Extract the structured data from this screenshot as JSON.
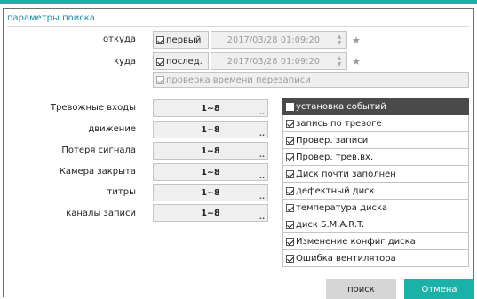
{
  "title": "параметры поиска",
  "from": {
    "label": "откуда",
    "mode_label": "первый",
    "mode_checked": true,
    "datetime": "2017/03/28  01:09:20"
  },
  "to": {
    "label": "куда",
    "mode_label": "послед.",
    "mode_checked": true,
    "datetime": "2017/03/28  01:09:20"
  },
  "verify_overwrite": {
    "label": "проверка времени перезаписи",
    "checked": true
  },
  "selectors": [
    {
      "label": "Тревожные входы",
      "value": "1~8"
    },
    {
      "label": "движение",
      "value": "1~8"
    },
    {
      "label": "Потеря сигнала",
      "value": "1~8"
    },
    {
      "label": "Камера закрыта",
      "value": "1~8"
    },
    {
      "label": "титры",
      "value": "1~8"
    },
    {
      "label": "каналы записи",
      "value": "1~8"
    }
  ],
  "events": [
    {
      "label": "установка событий",
      "checked": false
    },
    {
      "label": "запись по тревоге",
      "checked": true
    },
    {
      "label": "Провер. записи",
      "checked": true
    },
    {
      "label": "Провер. трев.вх.",
      "checked": true
    },
    {
      "label": "Диск почти заполнен",
      "checked": true
    },
    {
      "label": "дефектный диск",
      "checked": true
    },
    {
      "label": "температура диска",
      "checked": true
    },
    {
      "label": "диск S.M.A.R.T.",
      "checked": true
    },
    {
      "label": "Изменение конфиг диска",
      "checked": true
    },
    {
      "label": "Ошибка вентилятора",
      "checked": true
    }
  ],
  "buttons": {
    "search": "поиск",
    "cancel": "Отмена"
  },
  "colors": {
    "accent": "#1ab1a8",
    "title": "#1a8fa0",
    "header_row": "#4a4a4a"
  }
}
